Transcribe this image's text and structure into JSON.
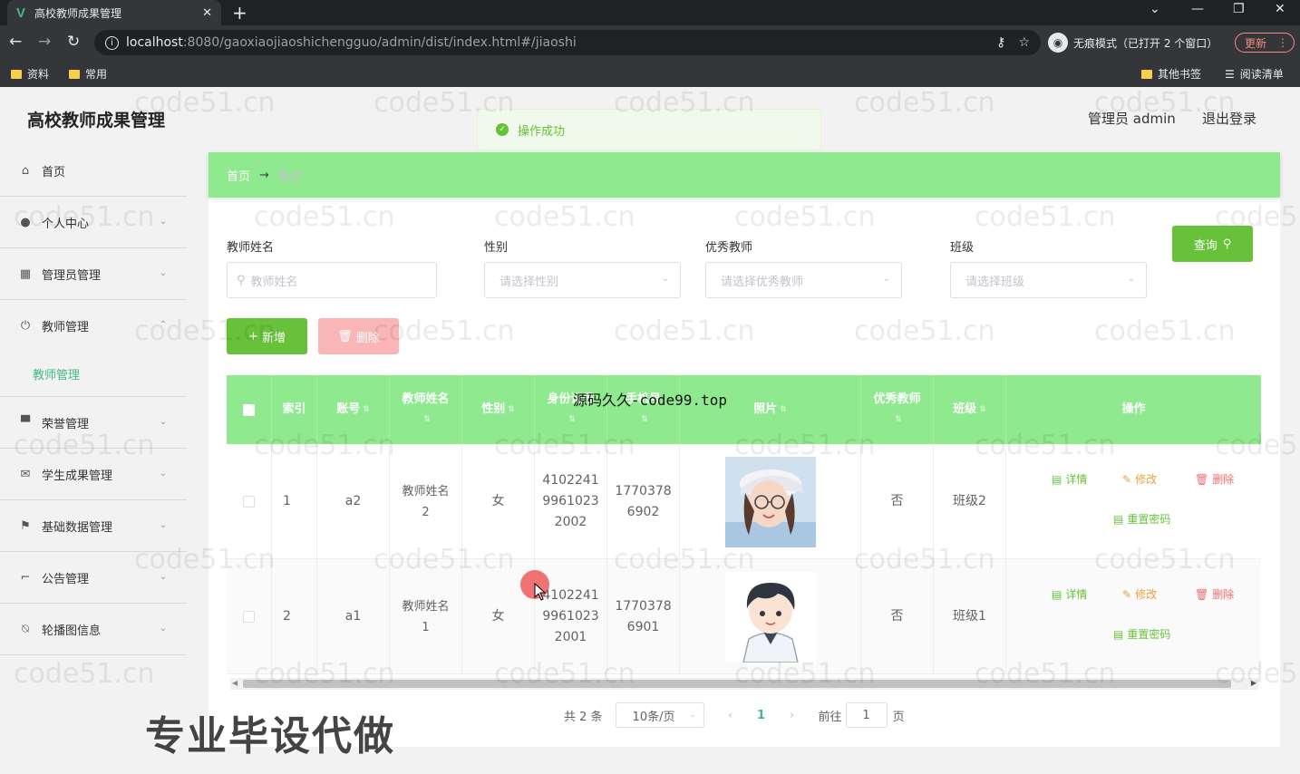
{
  "browser": {
    "tab_title": "高校教师成果管理",
    "url_host": "localhost",
    "url_path": ":8080/gaoxiaojiaoshichengguo/admin/dist/index.html#/jiaoshi",
    "incognito_label": "无痕模式（已打开 2 个窗口）",
    "update_label": "更新",
    "bookmarks": [
      "资料",
      "常用"
    ],
    "other_bookmarks": "其他书签",
    "reading_list": "阅读清单"
  },
  "header": {
    "title": "高校教师成果管理",
    "user": "管理员 admin",
    "logout": "退出登录"
  },
  "toast": {
    "message": "操作成功"
  },
  "sidebar": {
    "items": [
      {
        "label": "首页",
        "icon": "home-icon"
      },
      {
        "label": "个人中心",
        "icon": "user-icon"
      },
      {
        "label": "管理员管理",
        "icon": "grid-icon"
      },
      {
        "label": "教师管理",
        "icon": "power-icon"
      },
      {
        "label": "荣誉管理",
        "icon": "trophy-icon"
      },
      {
        "label": "学生成果管理",
        "icon": "mail-icon"
      },
      {
        "label": "基础数据管理",
        "icon": "flag-icon"
      },
      {
        "label": "公告管理",
        "icon": "crop-icon"
      },
      {
        "label": "轮播图信息",
        "icon": "bell-off-icon"
      }
    ],
    "submenu_active": "教师管理"
  },
  "breadcrumb": {
    "home": "首页",
    "arrow": "→",
    "current": "教师"
  },
  "search": {
    "name_label": "教师姓名",
    "name_placeholder": "教师姓名",
    "gender_label": "性别",
    "gender_placeholder": "请选择性别",
    "excellent_label": "优秀教师",
    "excellent_placeholder": "请选择优秀教师",
    "class_label": "班级",
    "class_placeholder": "请选择班级",
    "query_button": "查询"
  },
  "actions": {
    "add": "新增",
    "delete": "删除"
  },
  "table": {
    "columns": [
      "索引",
      "账号",
      "教师姓名",
      "性别",
      "身份证号",
      "手机号",
      "照片",
      "优秀教师",
      "班级",
      "操作"
    ],
    "rows": [
      {
        "index": "1",
        "account": "a2",
        "name": "教师姓名2",
        "gender": "女",
        "id_card": "410224119961023 2002",
        "phone": "17703786902",
        "excellent": "否",
        "class": "班级2"
      },
      {
        "index": "2",
        "account": "a1",
        "name": "教师姓名1",
        "gender": "女",
        "id_card": "410224119961023 2001",
        "phone": "17703786901",
        "excellent": "否",
        "class": "班级1"
      }
    ],
    "row_lines": [
      {
        "name": [
          "教师姓名",
          "2"
        ],
        "id_card": [
          "4102241",
          "9961023",
          "2002"
        ],
        "phone": [
          "1770378",
          "6902"
        ]
      },
      {
        "name": [
          "教师姓名",
          "1"
        ],
        "id_card": [
          "4102241",
          "9961023",
          "2001"
        ],
        "phone": [
          "1770378",
          "6901"
        ]
      }
    ],
    "ops": {
      "detail": "详情",
      "edit": "修改",
      "delete": "删除",
      "reset": "重置密码"
    }
  },
  "pagination": {
    "total": "共 2 条",
    "page_size": "10条/页",
    "current": "1",
    "goto_label": "前往",
    "goto_value": "1",
    "page_suffix": "页"
  },
  "overlays": {
    "watermark": "code51.cn",
    "code_text": "源码久久-code99.top",
    "ad_text": "专业毕设代做"
  },
  "colors": {
    "accent_green": "#8fea8f",
    "button_green": "#67c23a",
    "delete_pink": "#fab6b6",
    "active_menu": "#42b983"
  }
}
